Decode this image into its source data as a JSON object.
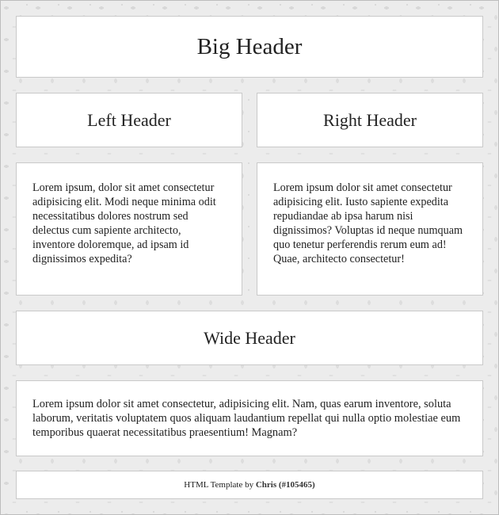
{
  "big_header": "Big Header",
  "left_header": "Left Header",
  "right_header": "Right Header",
  "left_text": "Lorem ipsum, dolor sit amet consectetur adipisicing elit. Modi neque minima odit necessitatibus dolores nostrum sed delectus cum sapiente architecto, inventore doloremque, ad ipsam id dignissimos expedita?",
  "right_text": "Lorem ipsum dolor sit amet consectetur adipisicing elit. Iusto sapiente expedita repudiandae ab ipsa harum nisi dignissimos? Voluptas id neque numquam quo tenetur perferendis rerum eum ad! Quae, architecto consectetur!",
  "wide_header": "Wide Header",
  "wide_text": "Lorem ipsum dolor sit amet consectetur, adipisicing elit. Nam, quas earum inventore, soluta laborum, veritatis voluptatem quos aliquam laudantium repellat qui nulla optio molestiae eum temporibus quaerat necessitatibus praesentium! Magnam?",
  "footer": {
    "prefix": "HTML Template by ",
    "author": "Chris",
    "id": "(#105465)"
  }
}
